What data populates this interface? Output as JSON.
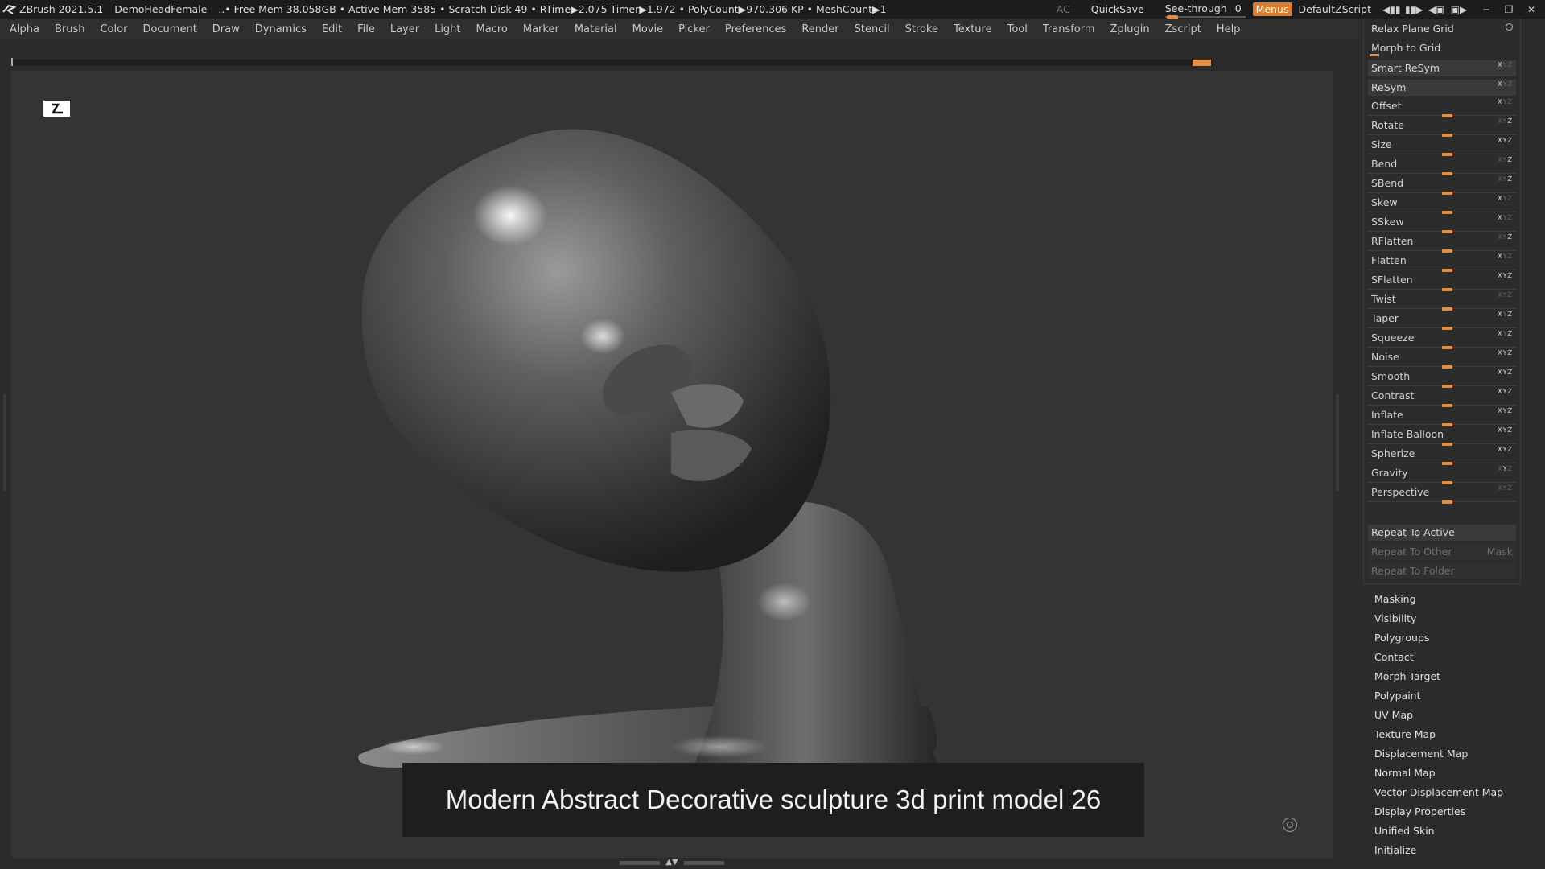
{
  "titlebar": {
    "app": "ZBrush 2021.5.1",
    "document": "DemoHeadFemale",
    "stats": "..• Free Mem 38.058GB • Active Mem 3585 • Scratch Disk 49 •  RTime▶2.075 Timer▶1.972 • PolyCount▶970.306 KP  • MeshCount▶1",
    "ac": "AC",
    "quicksave": "QuickSave",
    "see_through_label": "See-through",
    "see_through_value": "0",
    "see_through_level": 0,
    "menus": "Menus",
    "script": "DefaultZScript",
    "accent": "#e07b2a"
  },
  "menubar": [
    "Alpha",
    "Brush",
    "Color",
    "Document",
    "Draw",
    "Dynamics",
    "Edit",
    "File",
    "Layer",
    "Light",
    "Macro",
    "Marker",
    "Material",
    "Movie",
    "Picker",
    "Preferences",
    "Render",
    "Stencil",
    "Stroke",
    "Texture",
    "Tool",
    "Transform",
    "Zplugin",
    "Zscript",
    "Help"
  ],
  "viewport": {
    "caption": "Modern Abstract Decorative sculpture 3d print model 26",
    "background": "#343434"
  },
  "palette": {
    "top_buttons": [
      {
        "label": "Relax Plane Grid"
      },
      {
        "label": "Morph to Grid"
      },
      {
        "label": "Smart ReSym"
      },
      {
        "label": "ReSym"
      }
    ],
    "sliders": [
      {
        "label": "Offset",
        "x": true,
        "y": false,
        "z": false
      },
      {
        "label": "Rotate",
        "x": false,
        "y": false,
        "z": true
      },
      {
        "label": "Size",
        "x": true,
        "y": true,
        "z": true
      },
      {
        "label": "Bend",
        "x": false,
        "y": false,
        "z": true
      },
      {
        "label": "SBend",
        "x": false,
        "y": false,
        "z": true
      },
      {
        "label": "Skew",
        "x": true,
        "y": false,
        "z": false
      },
      {
        "label": "SSkew",
        "x": true,
        "y": false,
        "z": false
      },
      {
        "label": "RFlatten",
        "x": false,
        "y": false,
        "z": true
      },
      {
        "label": "Flatten",
        "x": true,
        "y": false,
        "z": false
      },
      {
        "label": "SFlatten",
        "x": true,
        "y": true,
        "z": true
      },
      {
        "label": "Twist",
        "x": false,
        "y": false,
        "z": false
      },
      {
        "label": "Taper",
        "x": true,
        "y": false,
        "z": true
      },
      {
        "label": "Squeeze",
        "x": true,
        "y": false,
        "z": true
      },
      {
        "label": "Noise",
        "x": true,
        "y": true,
        "z": true
      },
      {
        "label": "Smooth",
        "x": true,
        "y": true,
        "z": true
      },
      {
        "label": "Contrast",
        "x": true,
        "y": true,
        "z": true
      },
      {
        "label": "Inflate",
        "x": true,
        "y": true,
        "z": true
      },
      {
        "label": "Inflate Balloon",
        "x": true,
        "y": true,
        "z": true
      },
      {
        "label": "Spherize",
        "x": true,
        "y": true,
        "z": true
      },
      {
        "label": "Gravity",
        "x": false,
        "y": true,
        "z": false
      },
      {
        "label": "Perspective",
        "x": false,
        "y": false,
        "z": false
      }
    ],
    "repeat_active": "Repeat To Active",
    "repeat_other": "Repeat To Other",
    "mask": "Mask",
    "repeat_folder": "Repeat To Folder"
  },
  "subpalettes": [
    "Masking",
    "Visibility",
    "Polygroups",
    "Contact",
    "Morph Target",
    "Polypaint",
    "UV Map",
    "Texture Map",
    "Displacement Map",
    "Normal Map",
    "Vector Displacement Map",
    "Display Properties",
    "Unified Skin",
    "Initialize"
  ]
}
